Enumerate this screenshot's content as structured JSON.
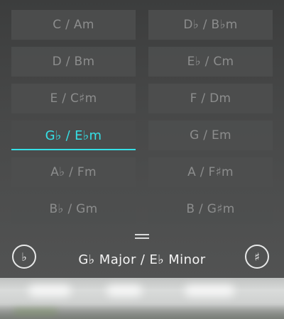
{
  "keys": [
    {
      "label": "C / Am",
      "selected": false
    },
    {
      "label": "D♭ / B♭m",
      "selected": false
    },
    {
      "label": "D / Bm",
      "selected": false
    },
    {
      "label": "E♭ / Cm",
      "selected": false
    },
    {
      "label": "E / C♯m",
      "selected": false
    },
    {
      "label": "F / Dm",
      "selected": false
    },
    {
      "label": "G♭ / E♭m",
      "selected": true
    },
    {
      "label": "G / Em",
      "selected": false
    },
    {
      "label": "A♭ / Fm",
      "selected": false
    },
    {
      "label": "A / F♯m",
      "selected": false
    },
    {
      "label": "B♭ / Gm",
      "selected": false
    },
    {
      "label": "B / G♯m",
      "selected": false
    }
  ],
  "controls": {
    "flat_symbol": "♭",
    "sharp_symbol": "♯",
    "current_key": "G♭ Major / E♭ Minor"
  },
  "colors": {
    "accent": "#35e0e6",
    "unselected_text": "#8c8d8d",
    "panel": "#484949"
  }
}
